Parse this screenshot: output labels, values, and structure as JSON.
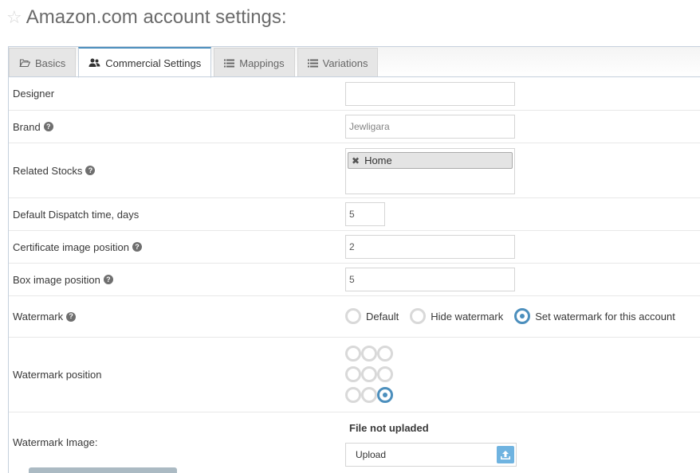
{
  "header": {
    "title": "Amazon.com account settings:"
  },
  "tabs": [
    {
      "label": "Basics",
      "icon": "folder-open-icon"
    },
    {
      "label": "Commercial Settings",
      "icon": "users-icon",
      "active": true
    },
    {
      "label": "Mappings",
      "icon": "list-icon"
    },
    {
      "label": "Variations",
      "icon": "list-icon"
    }
  ],
  "form": {
    "designer": {
      "label": "Designer",
      "value": "",
      "placeholder": ""
    },
    "brand": {
      "label": "Brand",
      "value": "Jewligara"
    },
    "related_stocks": {
      "label": "Related Stocks",
      "tags": [
        "Home"
      ]
    },
    "dispatch_time": {
      "label": "Default Dispatch time, days",
      "value": "5"
    },
    "certificate_position": {
      "label": "Certificate image position",
      "value": "2"
    },
    "box_position": {
      "label": "Box image position",
      "value": "5"
    },
    "watermark": {
      "label": "Watermark",
      "options": [
        "Default",
        "Hide watermark",
        "Set watermark for this account"
      ],
      "selected": "Set watermark for this account"
    },
    "watermark_position": {
      "label": "Watermark position",
      "selected": "bottom-right"
    },
    "watermark_image": {
      "label": "Watermark Image:",
      "status": "File not upladed",
      "upload_label": "Upload"
    }
  },
  "colors": {
    "accent": "#4c8fbd",
    "upload": "#6fb3e0"
  }
}
